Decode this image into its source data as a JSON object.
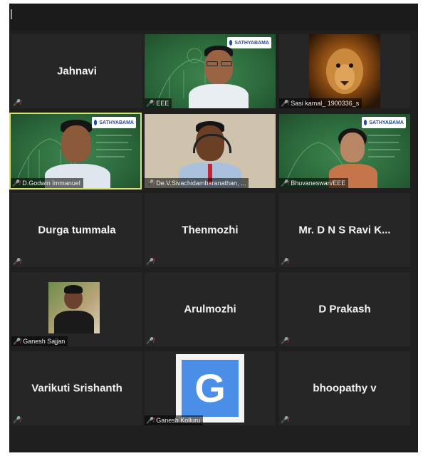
{
  "participants": [
    {
      "name": "Jahnavi",
      "label": "",
      "video": false,
      "muted": true
    },
    {
      "name": "",
      "label": "EEE",
      "video": true,
      "kind": "presenter-board",
      "logo": "SATHYABAMA",
      "muted": true
    },
    {
      "name": "",
      "label": "Sasi kamal_ 1900336_s",
      "video": true,
      "kind": "lion-avatar",
      "muted": true
    },
    {
      "name": "",
      "label": "D.Godwin Immanuel",
      "video": true,
      "kind": "board",
      "logo": "SATHYABAMA",
      "active": true,
      "muted": true
    },
    {
      "name": "",
      "label": "De.V.Sivachidambaranathan, ...",
      "video": true,
      "kind": "headset",
      "muted": true
    },
    {
      "name": "",
      "label": "Bhuvaneswari/EEE",
      "video": true,
      "kind": "board-woman",
      "logo": "SATHYABAMA",
      "muted": true
    },
    {
      "name": "Durga tummala",
      "label": "",
      "video": false,
      "muted": true
    },
    {
      "name": "Thenmozhi",
      "label": "",
      "video": false,
      "muted": true
    },
    {
      "name": "Mr. D N S Ravi K...",
      "label": "",
      "video": false,
      "muted": true
    },
    {
      "name": "",
      "label": "Ganesh Sajjan",
      "video": true,
      "kind": "photo",
      "muted": true
    },
    {
      "name": "Arulmozhi",
      "label": "",
      "video": false,
      "muted": true
    },
    {
      "name": "D Prakash",
      "label": "",
      "video": false,
      "muted": true
    },
    {
      "name": "Varikuti Srishanth",
      "label": "",
      "video": false,
      "muted": true
    },
    {
      "name": "",
      "label": "Ganesh Kolluru",
      "video": true,
      "kind": "google-avatar",
      "avatar_letter": "G",
      "muted": true
    },
    {
      "name": "bhoopathy v",
      "label": "",
      "video": false,
      "muted": true
    }
  ],
  "colors": {
    "tile_bg": "#262626",
    "active_border": "#d8e26a",
    "mic_muted": "#e0483c",
    "board_green": "#3f8450",
    "google_blue": "#4a8ee8"
  },
  "icons": {
    "muted": "mic-muted-icon"
  }
}
